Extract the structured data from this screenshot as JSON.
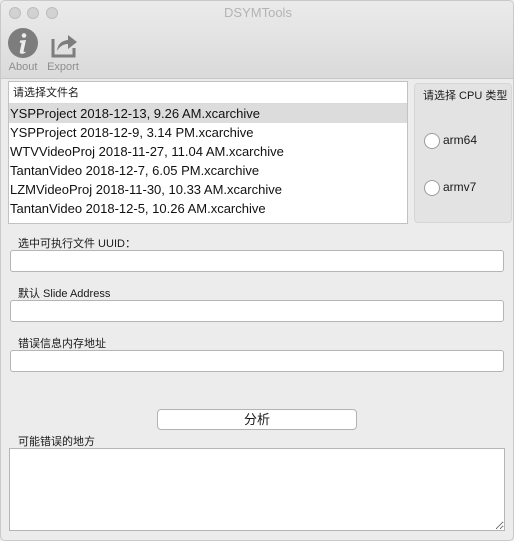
{
  "window": {
    "title": "DSYMTools"
  },
  "toolbar": {
    "about_label": "About",
    "export_label": "Export",
    "about_icon": "info-icon",
    "export_icon": "share-export-icon"
  },
  "file_list": {
    "header": "请选择文件名",
    "items": [
      "YSPProject 2018-12-13, 9.26 AM.xcarchive",
      "YSPProject 2018-12-9, 3.14 PM.xcarchive",
      "WTVVideoProj 2018-11-27, 11.04 AM.xcarchive",
      "TantanVideo 2018-12-7, 6.05 PM.xcarchive",
      "LZMVideoProj 2018-11-30, 10.33 AM.xcarchive",
      "TantanVideo 2018-12-5, 10.26 AM.xcarchive"
    ],
    "selected_index": 0
  },
  "cpu": {
    "title": "请选择 CPU 类型",
    "options": [
      "arm64",
      "armv7"
    ]
  },
  "fields": {
    "uuid_label": "选中可执行文件 UUID：",
    "uuid_value": "",
    "slide_label": "默认 Slide Address",
    "slide_value": "",
    "address_label": "错误信息内存地址",
    "address_value": ""
  },
  "analyze_button": "分析",
  "result": {
    "label": "可能错误的地方",
    "value": ""
  }
}
